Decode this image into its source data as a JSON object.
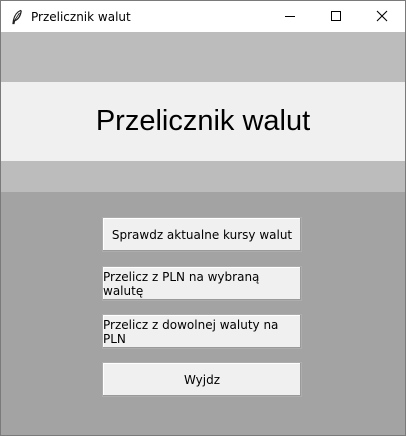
{
  "window": {
    "title": "Przelicznik walut",
    "icon": "feather-icon",
    "controls": [
      "minimize-icon",
      "maximize-icon",
      "close-icon"
    ]
  },
  "header": {
    "title": "Przelicznik walut"
  },
  "menu": {
    "buttons": [
      {
        "label": "Sprawdz aktualne kursy walut"
      },
      {
        "label": "Przelicz z PLN na wybraną walutę"
      },
      {
        "label": "Przelicz z dowolnej waluty na PLN"
      },
      {
        "label": "Wyjdz"
      }
    ]
  },
  "colors": {
    "client_bg": "#a3a3a3",
    "header_band": "#bcbcbc",
    "header_inner": "#f0f0f0",
    "button_bg": "#f0f0f0"
  }
}
